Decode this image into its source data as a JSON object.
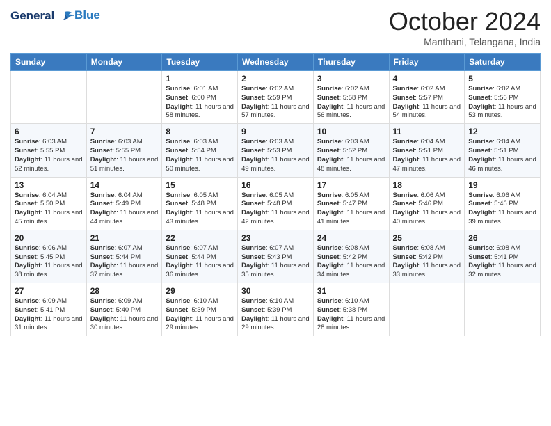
{
  "header": {
    "logo_line1": "General",
    "logo_line2": "Blue",
    "month_title": "October 2024",
    "location": "Manthani, Telangana, India"
  },
  "weekdays": [
    "Sunday",
    "Monday",
    "Tuesday",
    "Wednesday",
    "Thursday",
    "Friday",
    "Saturday"
  ],
  "weeks": [
    [
      {
        "day": "",
        "info": ""
      },
      {
        "day": "",
        "info": ""
      },
      {
        "day": "1",
        "info": "Sunrise: 6:01 AM\nSunset: 6:00 PM\nDaylight: 11 hours and 58 minutes."
      },
      {
        "day": "2",
        "info": "Sunrise: 6:02 AM\nSunset: 5:59 PM\nDaylight: 11 hours and 57 minutes."
      },
      {
        "day": "3",
        "info": "Sunrise: 6:02 AM\nSunset: 5:58 PM\nDaylight: 11 hours and 56 minutes."
      },
      {
        "day": "4",
        "info": "Sunrise: 6:02 AM\nSunset: 5:57 PM\nDaylight: 11 hours and 54 minutes."
      },
      {
        "day": "5",
        "info": "Sunrise: 6:02 AM\nSunset: 5:56 PM\nDaylight: 11 hours and 53 minutes."
      }
    ],
    [
      {
        "day": "6",
        "info": "Sunrise: 6:03 AM\nSunset: 5:55 PM\nDaylight: 11 hours and 52 minutes."
      },
      {
        "day": "7",
        "info": "Sunrise: 6:03 AM\nSunset: 5:55 PM\nDaylight: 11 hours and 51 minutes."
      },
      {
        "day": "8",
        "info": "Sunrise: 6:03 AM\nSunset: 5:54 PM\nDaylight: 11 hours and 50 minutes."
      },
      {
        "day": "9",
        "info": "Sunrise: 6:03 AM\nSunset: 5:53 PM\nDaylight: 11 hours and 49 minutes."
      },
      {
        "day": "10",
        "info": "Sunrise: 6:03 AM\nSunset: 5:52 PM\nDaylight: 11 hours and 48 minutes."
      },
      {
        "day": "11",
        "info": "Sunrise: 6:04 AM\nSunset: 5:51 PM\nDaylight: 11 hours and 47 minutes."
      },
      {
        "day": "12",
        "info": "Sunrise: 6:04 AM\nSunset: 5:51 PM\nDaylight: 11 hours and 46 minutes."
      }
    ],
    [
      {
        "day": "13",
        "info": "Sunrise: 6:04 AM\nSunset: 5:50 PM\nDaylight: 11 hours and 45 minutes."
      },
      {
        "day": "14",
        "info": "Sunrise: 6:04 AM\nSunset: 5:49 PM\nDaylight: 11 hours and 44 minutes."
      },
      {
        "day": "15",
        "info": "Sunrise: 6:05 AM\nSunset: 5:48 PM\nDaylight: 11 hours and 43 minutes."
      },
      {
        "day": "16",
        "info": "Sunrise: 6:05 AM\nSunset: 5:48 PM\nDaylight: 11 hours and 42 minutes."
      },
      {
        "day": "17",
        "info": "Sunrise: 6:05 AM\nSunset: 5:47 PM\nDaylight: 11 hours and 41 minutes."
      },
      {
        "day": "18",
        "info": "Sunrise: 6:06 AM\nSunset: 5:46 PM\nDaylight: 11 hours and 40 minutes."
      },
      {
        "day": "19",
        "info": "Sunrise: 6:06 AM\nSunset: 5:46 PM\nDaylight: 11 hours and 39 minutes."
      }
    ],
    [
      {
        "day": "20",
        "info": "Sunrise: 6:06 AM\nSunset: 5:45 PM\nDaylight: 11 hours and 38 minutes."
      },
      {
        "day": "21",
        "info": "Sunrise: 6:07 AM\nSunset: 5:44 PM\nDaylight: 11 hours and 37 minutes."
      },
      {
        "day": "22",
        "info": "Sunrise: 6:07 AM\nSunset: 5:44 PM\nDaylight: 11 hours and 36 minutes."
      },
      {
        "day": "23",
        "info": "Sunrise: 6:07 AM\nSunset: 5:43 PM\nDaylight: 11 hours and 35 minutes."
      },
      {
        "day": "24",
        "info": "Sunrise: 6:08 AM\nSunset: 5:42 PM\nDaylight: 11 hours and 34 minutes."
      },
      {
        "day": "25",
        "info": "Sunrise: 6:08 AM\nSunset: 5:42 PM\nDaylight: 11 hours and 33 minutes."
      },
      {
        "day": "26",
        "info": "Sunrise: 6:08 AM\nSunset: 5:41 PM\nDaylight: 11 hours and 32 minutes."
      }
    ],
    [
      {
        "day": "27",
        "info": "Sunrise: 6:09 AM\nSunset: 5:41 PM\nDaylight: 11 hours and 31 minutes."
      },
      {
        "day": "28",
        "info": "Sunrise: 6:09 AM\nSunset: 5:40 PM\nDaylight: 11 hours and 30 minutes."
      },
      {
        "day": "29",
        "info": "Sunrise: 6:10 AM\nSunset: 5:39 PM\nDaylight: 11 hours and 29 minutes."
      },
      {
        "day": "30",
        "info": "Sunrise: 6:10 AM\nSunset: 5:39 PM\nDaylight: 11 hours and 29 minutes."
      },
      {
        "day": "31",
        "info": "Sunrise: 6:10 AM\nSunset: 5:38 PM\nDaylight: 11 hours and 28 minutes."
      },
      {
        "day": "",
        "info": ""
      },
      {
        "day": "",
        "info": ""
      }
    ]
  ]
}
